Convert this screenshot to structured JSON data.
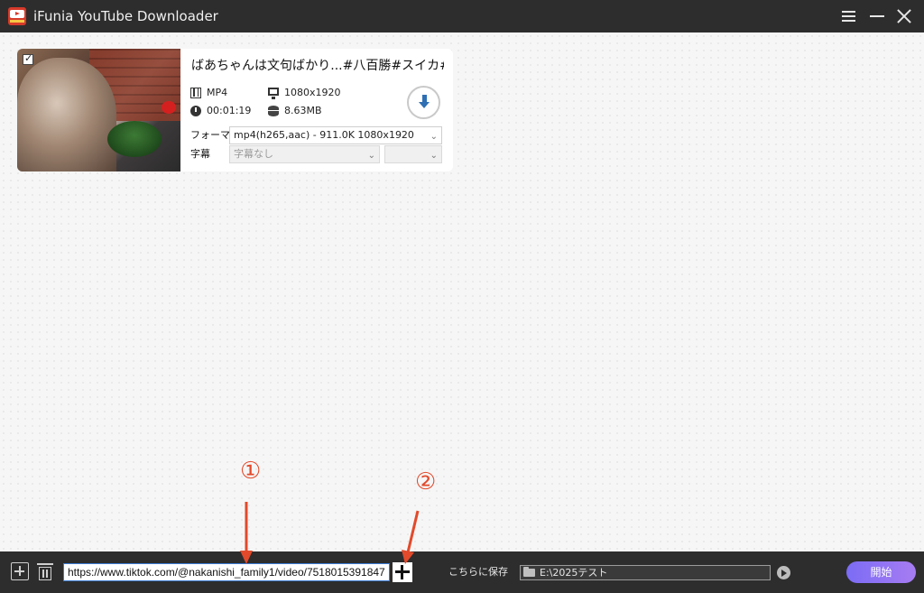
{
  "app": {
    "title": "iFunia YouTube Downloader"
  },
  "titlebar": {
    "menu_icon": "hamburger-menu-icon",
    "minimize_icon": "minimize-icon",
    "close_icon": "close-icon"
  },
  "video": {
    "title": "ばあちゃんは文句ばかり...#八百勝#スイカ#果物",
    "format": "MP4",
    "duration": "00:01:19",
    "resolution": "1080x1920",
    "size": "8.63MB",
    "format_label": "フォーマ",
    "format_option": "mp4(h265,aac) - 911.0K 1080x1920",
    "subtitle_label": "字幕",
    "subtitle_option": "字幕なし",
    "subtitle_lang_option": "",
    "checked": true
  },
  "bottom": {
    "url_value": "https://www.tiktok.com/@nakanishi_family1/video/7518015391847",
    "save_label": "こちらに保存",
    "save_path": "E:\\2025テスト",
    "start_label": "開始"
  },
  "annotations": {
    "marker1": "①",
    "marker2": "②",
    "color": "#e24a2b"
  },
  "colors": {
    "titlebar": "#2d2d2d",
    "accent": "#3c7bd3",
    "download": "#2f6fb3",
    "start_gradient": [
      "#7b6cf5",
      "#a77cf2"
    ]
  }
}
